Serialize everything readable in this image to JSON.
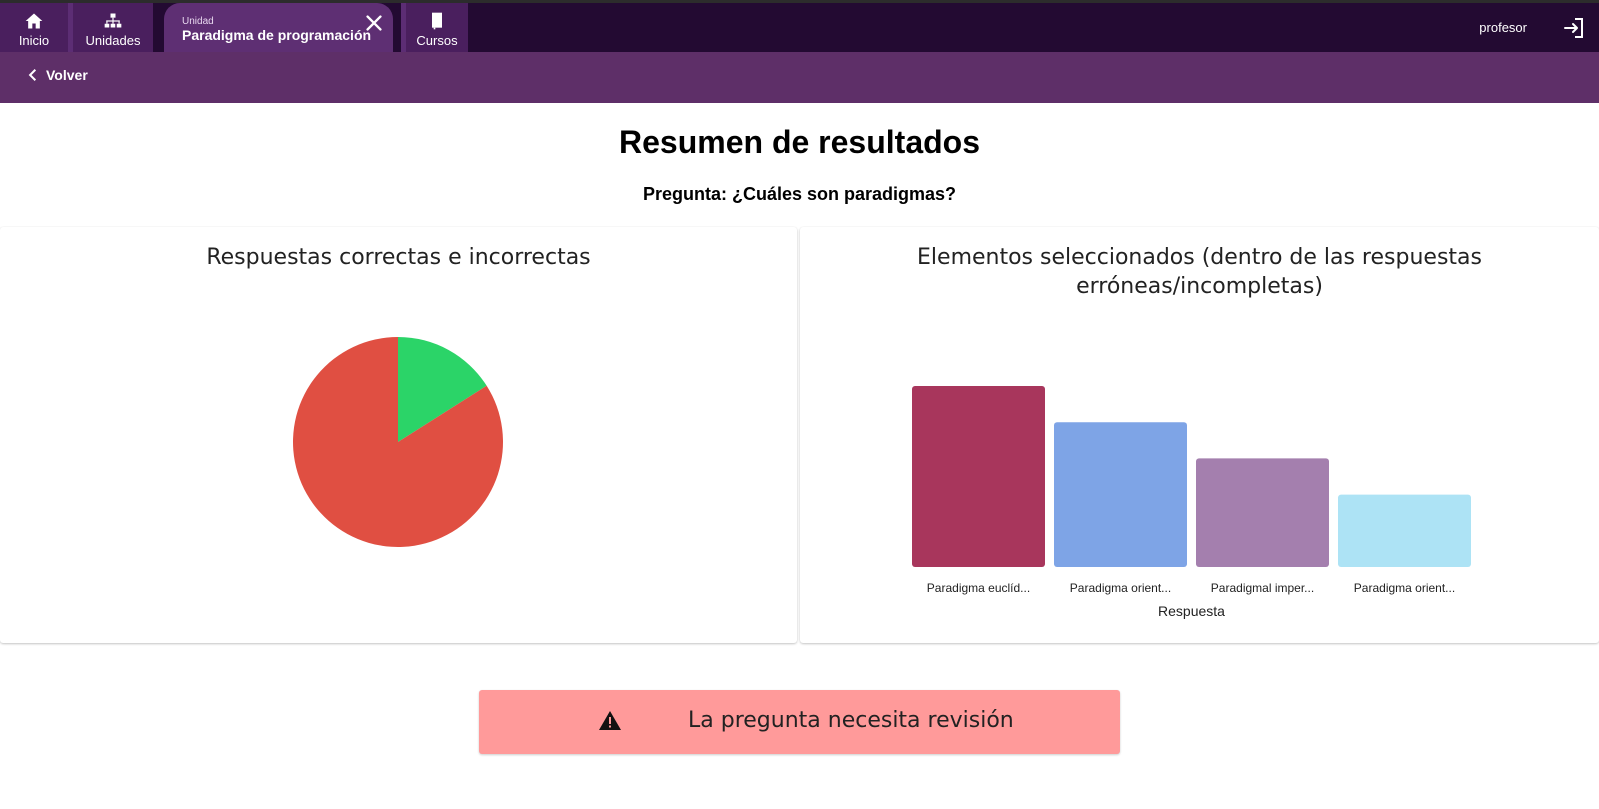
{
  "app": {
    "tabs": [
      {
        "label": "Inicio",
        "icon": "home-icon"
      },
      {
        "label": "Unidades",
        "icon": "sitemap-icon"
      },
      {
        "sublabel": "Unidad",
        "label": "Paradigma de programación",
        "icon": "close-icon",
        "active": true
      },
      {
        "label": "Cursos",
        "icon": "book-icon"
      }
    ],
    "user": "profesor",
    "logout_icon": "logout-icon"
  },
  "subbar": {
    "back_label": "Volver",
    "back_icon": "chevron-left-icon"
  },
  "main": {
    "title": "Resumen de resultados",
    "question": "Pregunta: ¿Cuáles son paradigmas?"
  },
  "colors": {
    "topbar": "#230a32",
    "subbar": "#5e2f68",
    "correct": "#2bd468",
    "incorrect": "#e04f42",
    "alert_bg": "#ff9a9a"
  },
  "chart_data": [
    {
      "type": "pie",
      "title": "Respuestas correctas e incorrectas",
      "slices": [
        {
          "value": 0.16,
          "color": "#2bd468"
        },
        {
          "value": 0.84,
          "color": "#e04f42"
        }
      ]
    },
    {
      "type": "bar",
      "title": "Elementos seleccionados (dentro de las respuestas erróneas/incompletas)",
      "xlabel": "Respuesta",
      "categories": [
        "Paradigma euclíd...",
        "Paradigma orient...",
        "Paradigmal imper...",
        "Paradigma orient..."
      ],
      "values": [
        4,
        3.2,
        2.4,
        1.6
      ],
      "colors": [
        "#a8365c",
        "#7ea4e6",
        "#a47fae",
        "#ade3f5"
      ],
      "ylim": [
        0,
        4
      ]
    }
  ],
  "alert": {
    "text": "La pregunta necesita revisión",
    "icon": "warning-icon"
  }
}
